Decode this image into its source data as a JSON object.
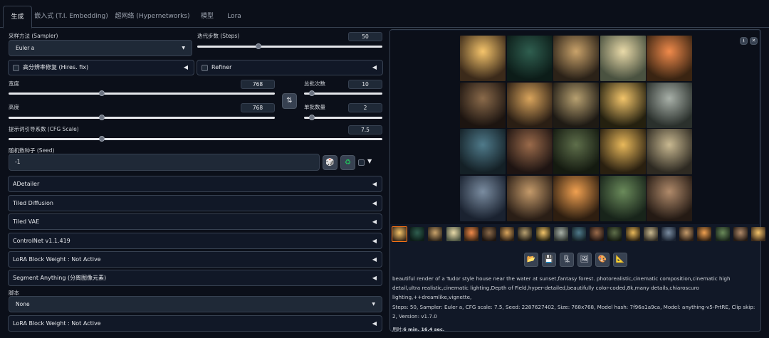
{
  "tabs": [
    "生成",
    "嵌入式 (T.I. Embedding)",
    "超网络 (Hypernetworks)",
    "模型",
    "Lora"
  ],
  "sampler": {
    "label": "采样方法 (Sampler)",
    "value": "Euler a"
  },
  "steps": {
    "label": "迭代步数 (Steps)",
    "value": "50",
    "level": 0.33
  },
  "hires": {
    "label": "高分辨率修复 (Hires. fix)"
  },
  "refiner": {
    "label": "Refiner"
  },
  "width": {
    "label": "宽度",
    "value": "768",
    "level": 0.35
  },
  "height": {
    "label": "高度",
    "value": "768",
    "level": 0.35
  },
  "batch_count": {
    "label": "总批次数",
    "value": "10",
    "level": 0.1
  },
  "batch_size": {
    "label": "单批数量",
    "value": "2",
    "level": 0.1
  },
  "cfg": {
    "label": "提示词引导系数 (CFG Scale)",
    "value": "7.5",
    "level": 0.25
  },
  "seed": {
    "label": "随机数种子 (Seed)",
    "value": "-1"
  },
  "swap_icon": "swap-icon",
  "accordions": [
    "ADetailer",
    "Tiled Diffusion",
    "Tiled VAE",
    "ControlNet v1.1.419",
    "LoRA Block Weight : Not Active",
    "Segment Anything (分离图像元素)"
  ],
  "script": {
    "label": "脚本",
    "value": "None"
  },
  "last_accordion": "LoRA Block Weight : Not Active",
  "gallery": {
    "tools": [
      "folder-icon",
      "save-icon",
      "zip-icon",
      "image-icon",
      "palette-icon",
      "ruler-icon"
    ],
    "info": "beautiful render of a Tudor style house near the water at sunset,fantasy forest. photorealistic,cinematic composition,cinematic high detail,ultra realistic,cinematic lighting,Depth of Field,hyper-detailed,beautifully color-coded,8k,many details,chiaroscuro lighting,++dreamlike,vignette,",
    "params": "Steps: 50, Sampler: Euler a, CFG scale: 7.5, Seed: 2287627402, Size: 768x768, Model hash: 7f96a1a9ca, Model: anything-v5-PrtRE, Clip skip: 2, Version: v1.7.0",
    "time_label": "用时:",
    "time_value": "6 min. 16.4 sec."
  },
  "colors": {
    "bg": "#0b0f19",
    "panel": "#111827",
    "border": "#374151",
    "accent": "#22c55e"
  }
}
